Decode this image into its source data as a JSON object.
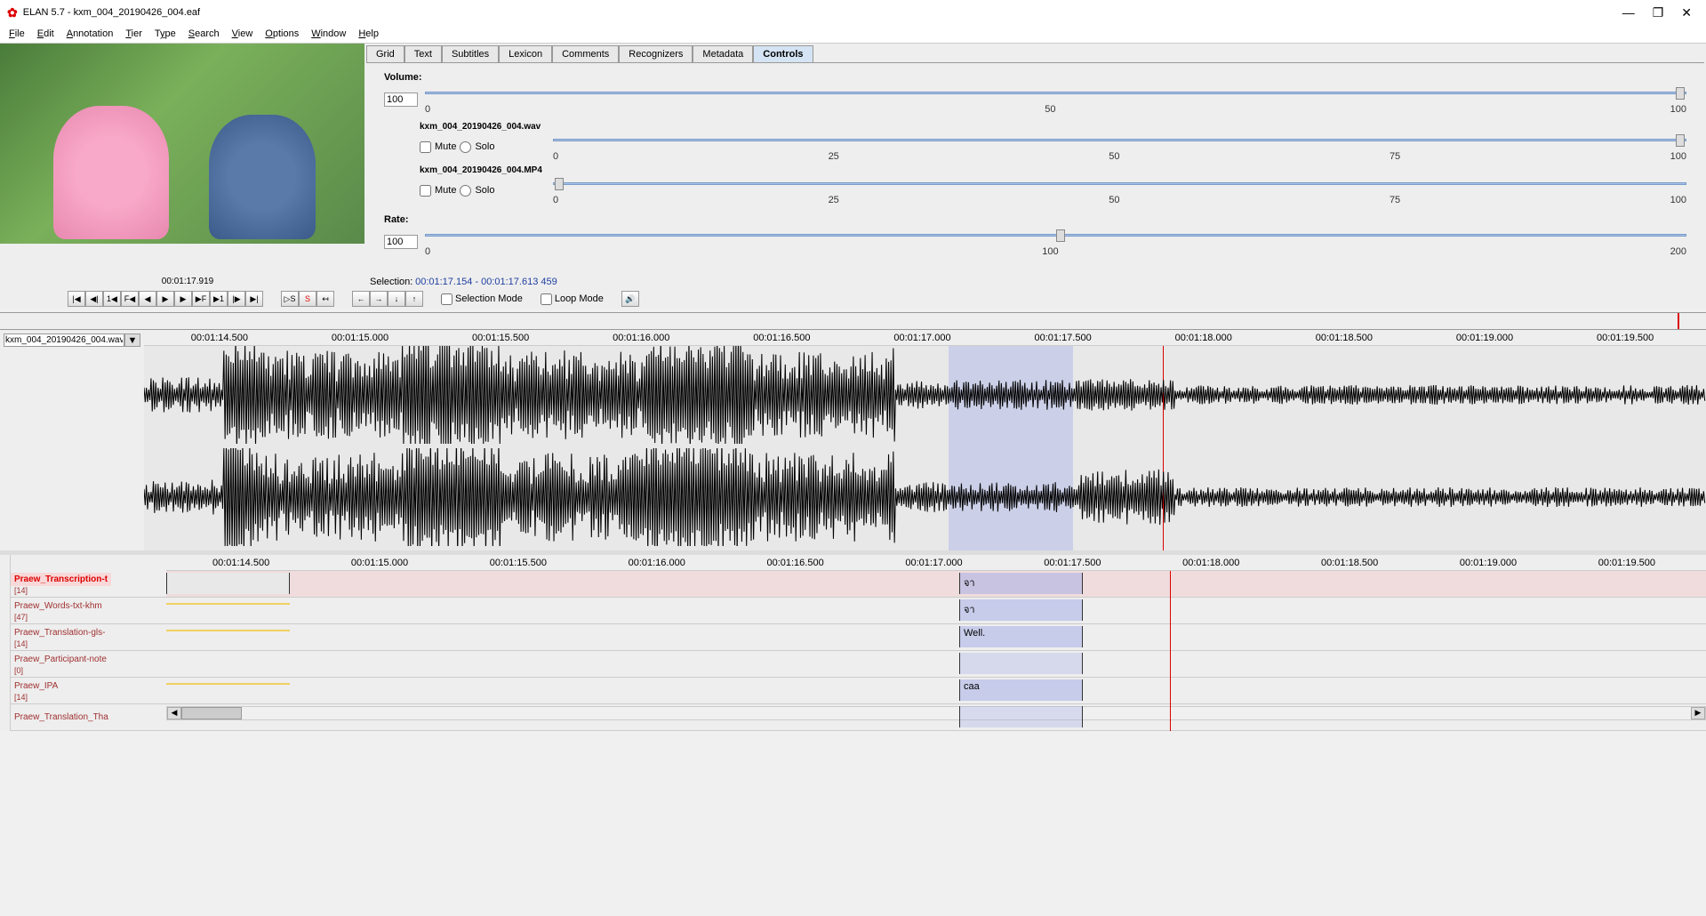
{
  "window": {
    "title": "ELAN 5.7 - kxm_004_20190426_004.eaf",
    "minimize": "—",
    "maximize": "❐",
    "close": "✕"
  },
  "menu": {
    "file": "File",
    "edit": "Edit",
    "annotation": "Annotation",
    "tier": "Tier",
    "type": "Type",
    "search": "Search",
    "view": "View",
    "options": "Options",
    "window": "Window",
    "help": "Help"
  },
  "tabs": {
    "grid": "Grid",
    "text": "Text",
    "subtitles": "Subtitles",
    "lexicon": "Lexicon",
    "comments": "Comments",
    "recognizers": "Recognizers",
    "metadata": "Metadata",
    "controls": "Controls"
  },
  "controls": {
    "volume_label": "Volume:",
    "volume_value": "100",
    "vol_ticks": {
      "t0": "0",
      "t1": "50",
      "t2": "100"
    },
    "media1": "kxm_004_20190426_004.wav",
    "media2": "kxm_004_20190426_004.MP4",
    "mute": "Mute",
    "solo": "Solo",
    "media_ticks": {
      "t0": "0",
      "t1": "25",
      "t2": "50",
      "t3": "75",
      "t4": "100"
    },
    "rate_label": "Rate:",
    "rate_value": "100",
    "rate_ticks": {
      "t0": "0",
      "t1": "100",
      "t2": "200"
    }
  },
  "time": {
    "current": "00:01:17.919",
    "selection_label": "Selection:",
    "selection_value": "00:01:17.154 - 00:01:17.613  459"
  },
  "playback": {
    "sel_mode": "Selection Mode",
    "loop_mode": "Loop Mode"
  },
  "waveform": {
    "file": "kxm_004_20190426_004.wav"
  },
  "ruler": {
    "t0": "00:01:14.500",
    "t1": "00:01:15.000",
    "t2": "00:01:15.500",
    "t3": "00:01:16.000",
    "t4": "00:01:16.500",
    "t5": "00:01:17.000",
    "t6": "00:01:17.500",
    "t7": "00:01:18.000",
    "t8": "00:01:18.500",
    "t9": "00:01:19.000",
    "t10": "00:01:19.500"
  },
  "tiers": [
    {
      "name": "Praew_Transcription-t",
      "count": "[14]",
      "active": true
    },
    {
      "name": "Praew_Words-txt-khm",
      "count": "[47]"
    },
    {
      "name": "Praew_Translation-gls-",
      "count": "[14]"
    },
    {
      "name": "Praew_Participant-note",
      "count": "[0]"
    },
    {
      "name": "Praew_IPA",
      "count": "[14]"
    },
    {
      "name": "Praew_Translation_Tha",
      "count": ""
    }
  ],
  "annotations": {
    "transcription": "จา",
    "words": "จา",
    "translation": "Well.",
    "ipa": "caa"
  }
}
